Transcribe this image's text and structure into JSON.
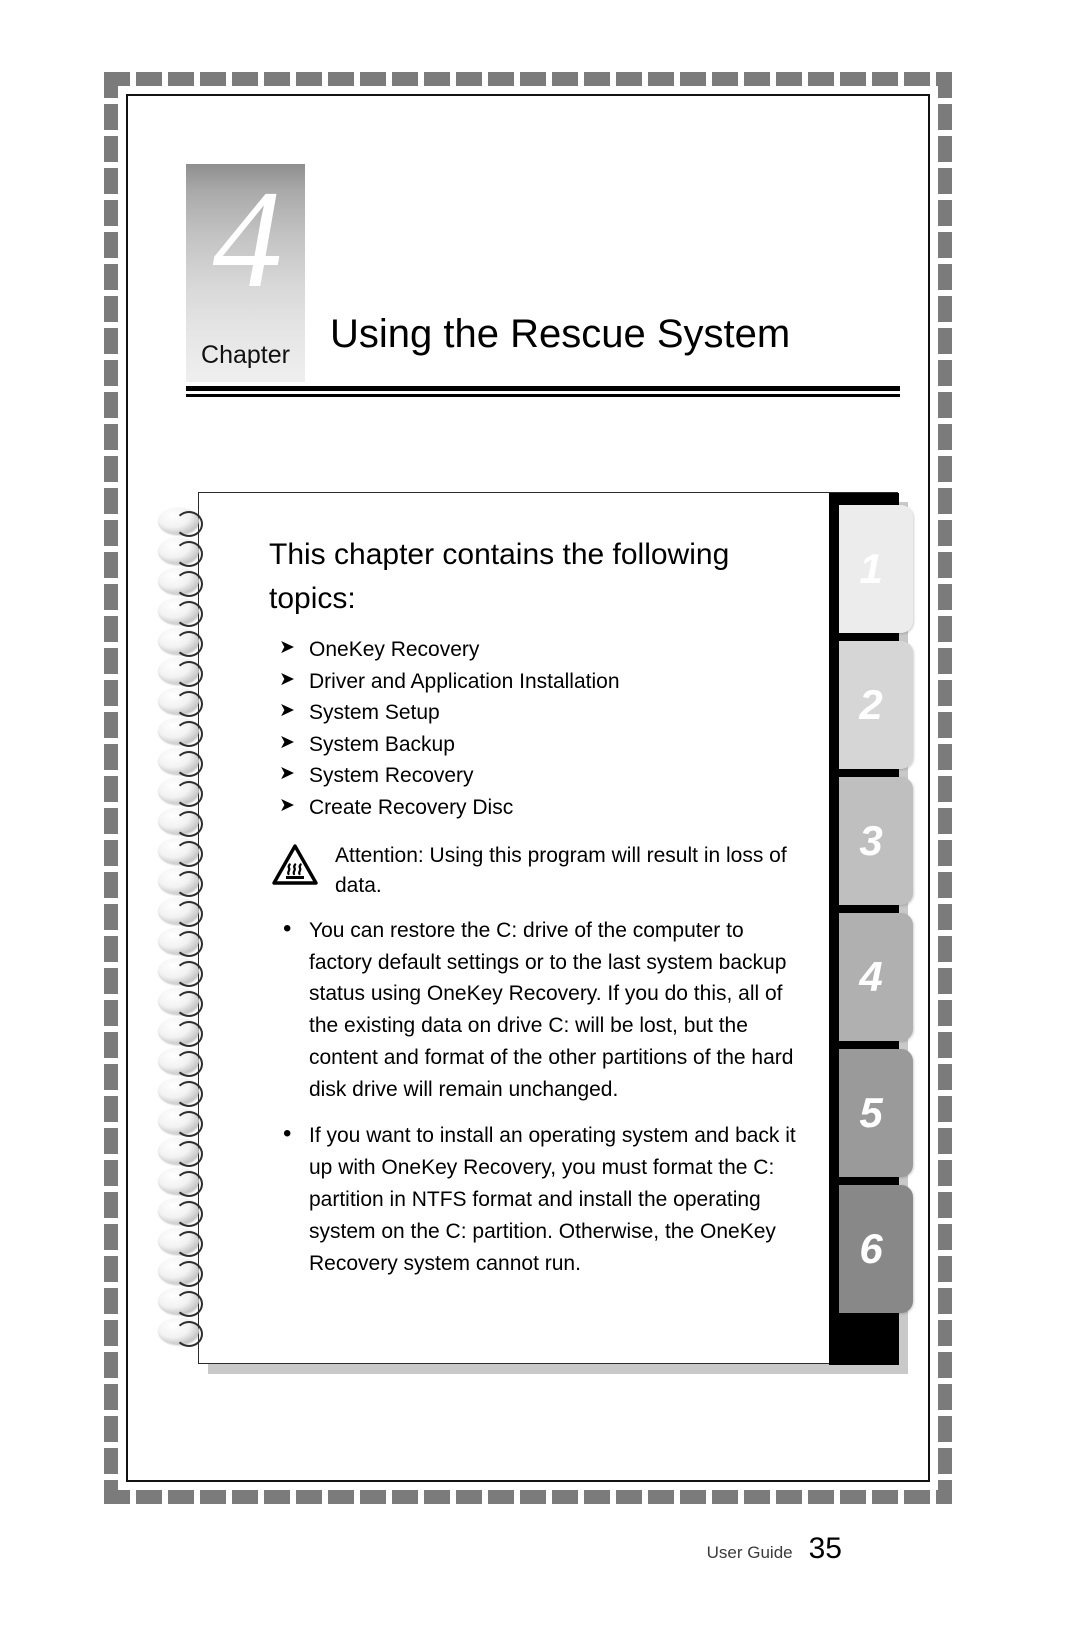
{
  "chapter": {
    "number": "4",
    "word": "Chapter",
    "title": "Using the Rescue System"
  },
  "notebook": {
    "heading": "This chapter contains the following topics:",
    "topics": [
      "OneKey Recovery",
      "Driver and Application Installation",
      "System Setup",
      "System Backup",
      "System Recovery",
      "Create Recovery Disc"
    ],
    "topic_marker": "➤",
    "attention": {
      "icon": "hot-surface-warning-icon",
      "text": "Attention: Using this program will result in loss of data."
    },
    "notes": [
      "You can restore the C: drive of the computer to factory default settings or to the last system backup status using OneKey Recovery. If you do this, all of the existing data on drive C: will be lost, but the content and format of the other partitions of the hard disk drive will remain unchanged.",
      "If you want to install an operating system and back it up with OneKey Recovery, you must format the C: partition in NTFS format and install the operating system on the C: partition. Otherwise, the OneKey Recovery system cannot run."
    ],
    "note_marker": "•",
    "tabs": [
      {
        "label": "1",
        "color": "#ececec"
      },
      {
        "label": "2",
        "color": "#d6d6d6"
      },
      {
        "label": "3",
        "color": "#bfbfbf"
      },
      {
        "label": "4",
        "color": "#b0b0b0"
      },
      {
        "label": "5",
        "color": "#9a9a9a"
      },
      {
        "label": "6",
        "color": "#888888"
      }
    ]
  },
  "footer": {
    "label": "User Guide",
    "page": "35"
  },
  "colors": {
    "border_dash": "#7b7b7b",
    "rule": "#000000",
    "page_background": "#ffffff"
  }
}
